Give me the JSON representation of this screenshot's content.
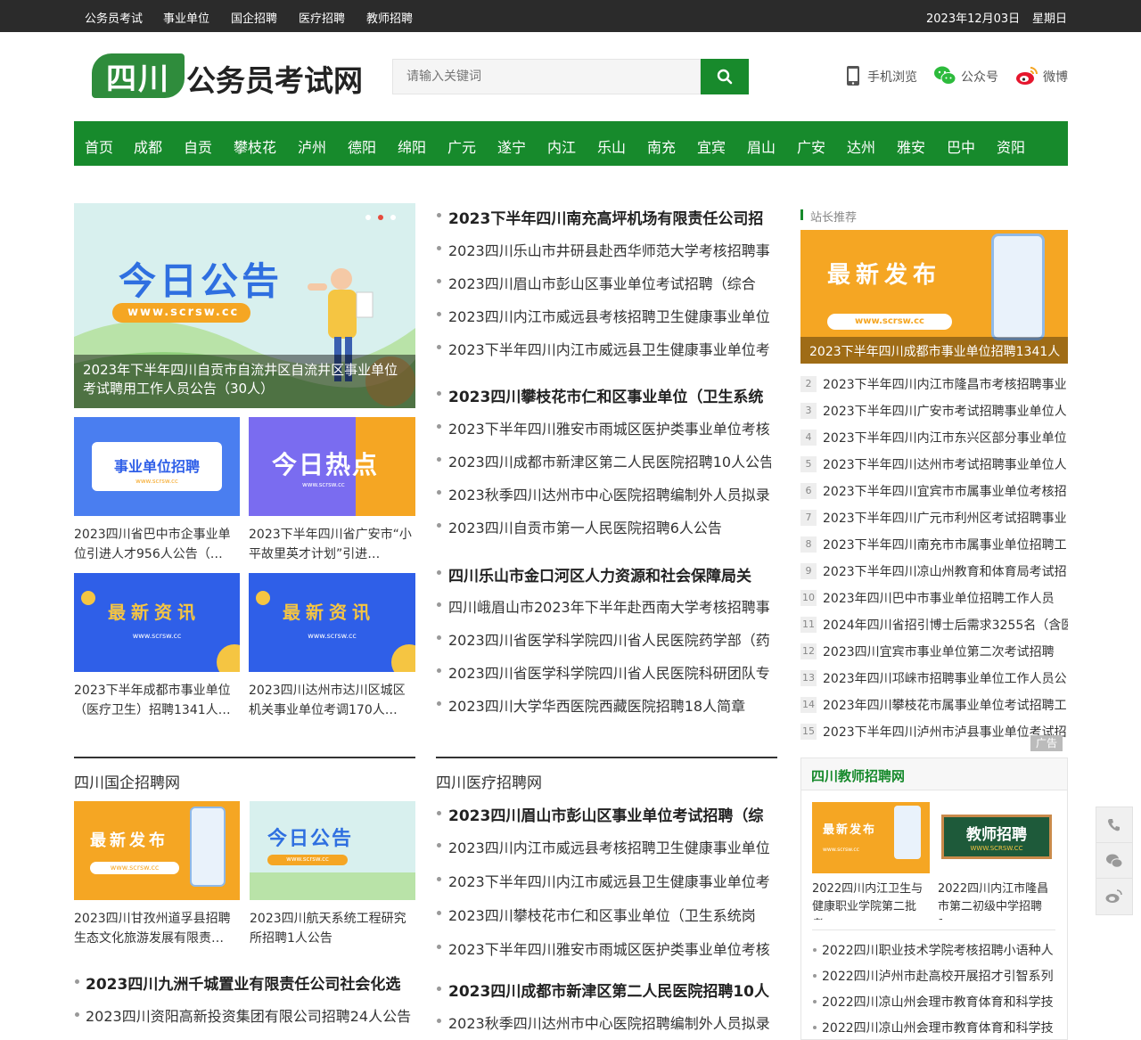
{
  "topbar": {
    "links": [
      "公务员考试",
      "事业单位",
      "国企招聘",
      "医疗招聘",
      "教师招聘"
    ],
    "date": "2023年12月03日",
    "weekday": "星期日"
  },
  "logo": {
    "region": "四川",
    "text": "公务员考试网"
  },
  "search": {
    "placeholder": "请输入关键词"
  },
  "header_links": {
    "mobile": "手机浏览",
    "wechat": "公众号",
    "weibo": "微博"
  },
  "nav": [
    "首页",
    "成都",
    "自贡",
    "攀枝花",
    "泸州",
    "德阳",
    "绵阳",
    "广元",
    "遂宁",
    "内江",
    "乐山",
    "南充",
    "宜宾",
    "眉山",
    "广安",
    "达州",
    "雅安",
    "巴中",
    "资阳"
  ],
  "banner": {
    "title": "2023年下半年四川自贡市自流井区自流井区事业单位考试聘用工作人员公告（30人）",
    "image_text": "今日公告",
    "image_url": "www.scrsw.cc"
  },
  "grid": [
    {
      "image_text": "事业单位招聘",
      "image_url": "www.scrsw.cc",
      "caption": "2023四川省巴中市企事业单位引进人才956人公告（…"
    },
    {
      "image_text": "今日热点",
      "image_url": "www.scrsw.cc",
      "caption": "2023下半年四川省广安市“小平故里英才计划”引进…"
    },
    {
      "image_text": "最新资讯",
      "image_url": "www.scrsw.cc",
      "caption": "2023下半年成都市事业单位（医疗卫生）招聘1341人…"
    },
    {
      "image_text": "最新资讯",
      "image_url": "www.scrsw.cc",
      "caption": "2023四川达州市达川区城区机关事业单位考调170人…"
    }
  ],
  "news_groups": [
    {
      "head": "2023下半年四川南充高坪机场有限责任公司招",
      "items": [
        "2023四川乐山市井研县赴西华师范大学考核招聘事",
        "2023四川眉山市彭山区事业单位考试招聘（综合",
        "2023四川内江市威远县考核招聘卫生健康事业单位",
        "2023下半年四川内江市威远县卫生健康事业单位考"
      ]
    },
    {
      "head": "2023四川攀枝花市仁和区事业单位（卫生系统",
      "items": [
        "2023下半年四川雅安市雨城区医护类事业单位考核",
        "2023四川成都市新津区第二人民医院招聘10人公告",
        "2023秋季四川达州市中心医院招聘编制外人员拟录",
        "2023四川自贡市第一人民医院招聘6人公告"
      ]
    },
    {
      "head": "四川乐山市金口河区人力资源和社会保障局关",
      "items": [
        "四川峨眉山市2023年下半年赴西南大学考核招聘事",
        "2023四川省医学科学院四川省人民医院药学部（药",
        "2023四川省医学科学院四川省人民医院科研团队专",
        "2023四川大学华西医院西藏医院招聘18人简章"
      ]
    }
  ],
  "sidebar": {
    "title": "站长推荐",
    "featured": {
      "image_text": "最新发布",
      "image_url": "www.scrsw.cc",
      "caption": "2023下半年四川成都市事业单位招聘1341人"
    },
    "ranks": [
      {
        "n": "2",
        "t": "2023下半年四川内江市隆昌市考核招聘事业"
      },
      {
        "n": "3",
        "t": "2023下半年四川广安市考试招聘事业单位人"
      },
      {
        "n": "4",
        "t": "2023下半年四川内江市东兴区部分事业单位"
      },
      {
        "n": "5",
        "t": "2023下半年四川达州市考试招聘事业单位人"
      },
      {
        "n": "6",
        "t": "2023下半年四川宜宾市市属事业单位考核招"
      },
      {
        "n": "7",
        "t": "2023下半年四川广元市利州区考试招聘事业"
      },
      {
        "n": "8",
        "t": "2023下半年四川南充市市属事业单位招聘工"
      },
      {
        "n": "9",
        "t": "2023下半年四川凉山州教育和体育局考试招"
      },
      {
        "n": "10",
        "t": "2023年四川巴中市事业单位招聘工作人员"
      },
      {
        "n": "11",
        "t": "2024年四川省招引博士后需求3255名（含医"
      },
      {
        "n": "12",
        "t": "2023四川宜宾市事业单位第二次考试招聘"
      },
      {
        "n": "13",
        "t": "2023年四川邛崃市招聘事业单位工作人员公"
      },
      {
        "n": "14",
        "t": "2023年四川攀枝花市属事业单位考试招聘工"
      },
      {
        "n": "15",
        "t": "2023下半年四川泸州市泸县事业单位考试招"
      }
    ],
    "ad_label": "广告",
    "teacher": {
      "title": "四川教师招聘网",
      "cards": [
        {
          "image_text": "最新发布",
          "image_url": "www.scrsw.cc",
          "caption": "2022四川内江卫生与健康职业学院第二批考…"
        },
        {
          "image_text": "教师招聘",
          "image_url": "WWW.SCRSW.CC",
          "caption": "2022四川内江市隆昌市第二初级中学招聘1…"
        }
      ],
      "items": [
        "2022四川职业技术学院考核招聘小语种人",
        "2022四川泸州市赴高校开展招才引智系列",
        "2022四川凉山州会理市教育体育和科学技",
        "2022四川凉山州会理市教育体育和科学技"
      ]
    }
  },
  "section_soe": {
    "title": "四川国企招聘网",
    "cards": [
      {
        "image_text": "最新发布",
        "image_url": "www.scrsw.cc",
        "caption": "2023四川甘孜州道孚县招聘生态文化旅游发展有限责…"
      },
      {
        "image_text": "今日公告",
        "image_url": "www.scrsw.cc",
        "caption": "2023四川航天系统工程研究所招聘1人公告"
      }
    ],
    "head": "2023四川九洲千城置业有限责任公司社会化选",
    "items": [
      "2023四川资阳高新投资集团有限公司招聘24人公告"
    ]
  },
  "section_med": {
    "title": "四川医疗招聘网",
    "head1": "2023四川眉山市彭山区事业单位考试招聘（综",
    "items1": [
      "2023四川内江市威远县考核招聘卫生健康事业单位",
      "2023下半年四川内江市威远县卫生健康事业单位考",
      "2023四川攀枝花市仁和区事业单位（卫生系统岗",
      "2023下半年四川雅安市雨城区医护类事业单位考核"
    ],
    "head2": "2023四川成都市新津区第二人民医院招聘10人",
    "items2": [
      "2023秋季四川达州市中心医院招聘编制外人员拟录"
    ]
  },
  "colors": {
    "green": "#178a2c",
    "topbar": "#2b2b2b",
    "orange": "#f5a623",
    "blue": "#2f5fe8"
  }
}
